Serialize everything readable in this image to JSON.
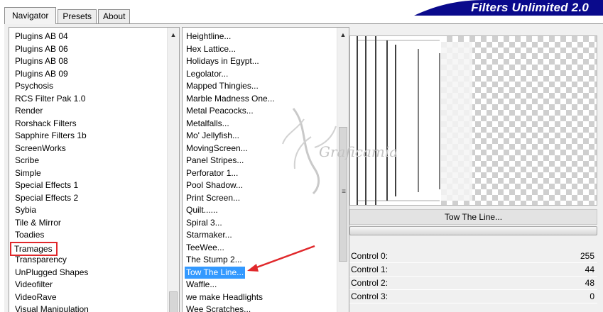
{
  "tabs": [
    {
      "label": "Navigator",
      "active": true
    },
    {
      "label": "Presets",
      "active": false
    },
    {
      "label": "About",
      "active": false
    }
  ],
  "brand": {
    "title": "Filters Unlimited 2.0",
    "color": "#0a0a8c"
  },
  "categories": {
    "items": [
      "Plugins AB 04",
      "Plugins AB 06",
      "Plugins AB 08",
      "Plugins AB 09",
      "Psychosis",
      "RCS Filter Pak 1.0",
      "Render",
      "Rorshack Filters",
      "Sapphire Filters 1b",
      "ScreenWorks",
      "Scribe",
      "Simple",
      "Special Effects 1",
      "Special Effects 2",
      "Sybia",
      "Tile & Mirror",
      "Toadies",
      "Tramages",
      "Transparency",
      "UnPlugged Shapes",
      "Videofilter",
      "VideoRave",
      "Visual Manipulation"
    ],
    "highlighted": "Tramages",
    "highlight_color": "#e0282b"
  },
  "filters": {
    "items": [
      "Heightline...",
      "Hex Lattice...",
      "Holidays in Egypt...",
      "Legolator...",
      "Mapped Thingies...",
      "Marble Madness One...",
      "Metal Peacocks...",
      "Metalfalls...",
      "Mo' Jellyfish...",
      "MovingScreen...",
      "Panel Stripes...",
      "Perforator 1...",
      "Pool Shadow...",
      "Print Screen...",
      "Quilt......",
      "Spiral 3...",
      "Starmaker...",
      "TeeWee...",
      "The Stump 2...",
      "Tow The Line...",
      "Waffle...",
      "we make Headlights",
      "Wee Scratches..."
    ],
    "selected": "Tow The Line...",
    "selected_color": "#3399ff"
  },
  "preview": {
    "filter_name": "Tow The Line..."
  },
  "controls": [
    {
      "label": "Control 0:",
      "value": "255"
    },
    {
      "label": "Control 1:",
      "value": "44"
    },
    {
      "label": "Control 2:",
      "value": "48"
    },
    {
      "label": "Control 3:",
      "value": "0"
    }
  ],
  "watermark": {
    "text": "Graficamia"
  },
  "icons": {
    "scroll_up": "arrow-up-icon",
    "grip": "scroll-grip-icon",
    "pointer": "red-arrow-icon"
  }
}
